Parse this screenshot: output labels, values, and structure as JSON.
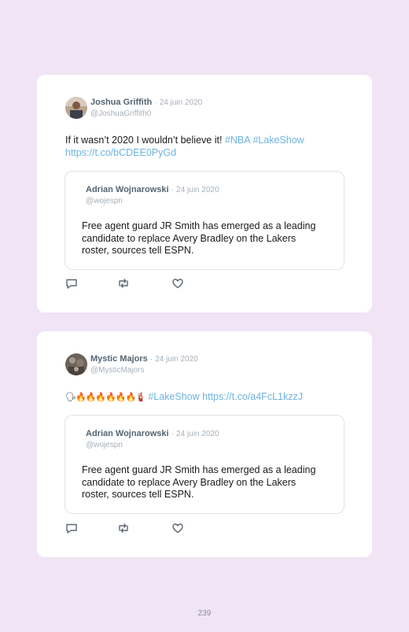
{
  "tweets": [
    {
      "author": {
        "name": "Joshua Griffith",
        "handle": "@JoshuaGriffith0",
        "avatar": "profile-photo"
      },
      "separator": "·",
      "date": "24 juin 2020",
      "text": "If it wasn’t 2020 I wouldn’t believe it!",
      "hashtags": [
        "#NBA",
        "#LakeShow"
      ],
      "link": "https://t.co/bCDEE0PyGd",
      "quoted": {
        "name": "Adrian Wojnarowski",
        "date": "24 juin 2020",
        "handle": "@wojespn",
        "text": "Free agent guard JR Smith has emerged as a leading candidate to replace Avery Bradley on the Lakers roster, sources tell ESPN."
      },
      "actions": [
        "reply-icon",
        "retweet-icon",
        "like-icon"
      ]
    },
    {
      "author": {
        "name": "Mystic Majors",
        "handle": "@MysticMajors",
        "avatar": "profile-photo"
      },
      "separator": "·",
      "date": "24 juin 2020",
      "emojis": "🗣🔥🔥🔥🔥🔥🔥🧯",
      "hashtag": "#LakeShow",
      "link": "https://t.co/a4FcL1kzzJ",
      "quoted": {
        "name": "Adrian Wojnarowski",
        "date": "24 juin 2020",
        "handle": "@wojespn",
        "text": "Free agent guard JR Smith has emerged as a leading candidate to replace Avery Bradley on the Lakers roster, sources tell ESPN."
      },
      "actions": [
        "reply-icon",
        "retweet-icon",
        "like-icon"
      ]
    }
  ],
  "page_number": "239",
  "colors": {
    "background": "#f1e4f5",
    "card": "#ffffff",
    "link": "#6cb3e0",
    "name": "#536471",
    "muted": "#a7b0ba",
    "border": "#dfe3e8"
  }
}
